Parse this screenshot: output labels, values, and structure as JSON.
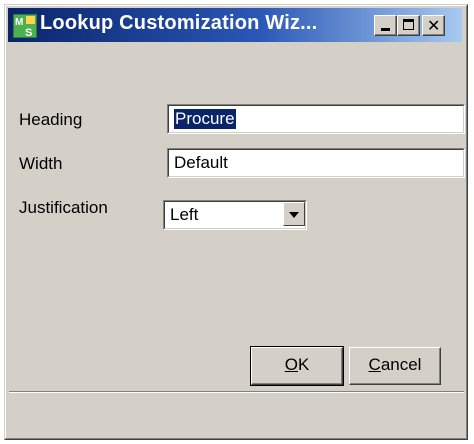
{
  "window": {
    "title": "Lookup Customization Wiz...",
    "app_icon": "app-icon"
  },
  "form": {
    "heading": {
      "label": "Heading",
      "value": "Procure"
    },
    "width": {
      "label": "Width",
      "value": "Default"
    },
    "justification": {
      "label": "Justification",
      "value": "Left"
    }
  },
  "buttons": {
    "ok": {
      "mnemonic": "O",
      "rest": "K"
    },
    "cancel": {
      "mnemonic": "C",
      "rest": "ancel"
    }
  },
  "colors": {
    "titlebar_start": "#0a246a",
    "titlebar_end": "#a6caf0",
    "dialog_face": "#d4d0c8",
    "selection": "#0a246a"
  }
}
